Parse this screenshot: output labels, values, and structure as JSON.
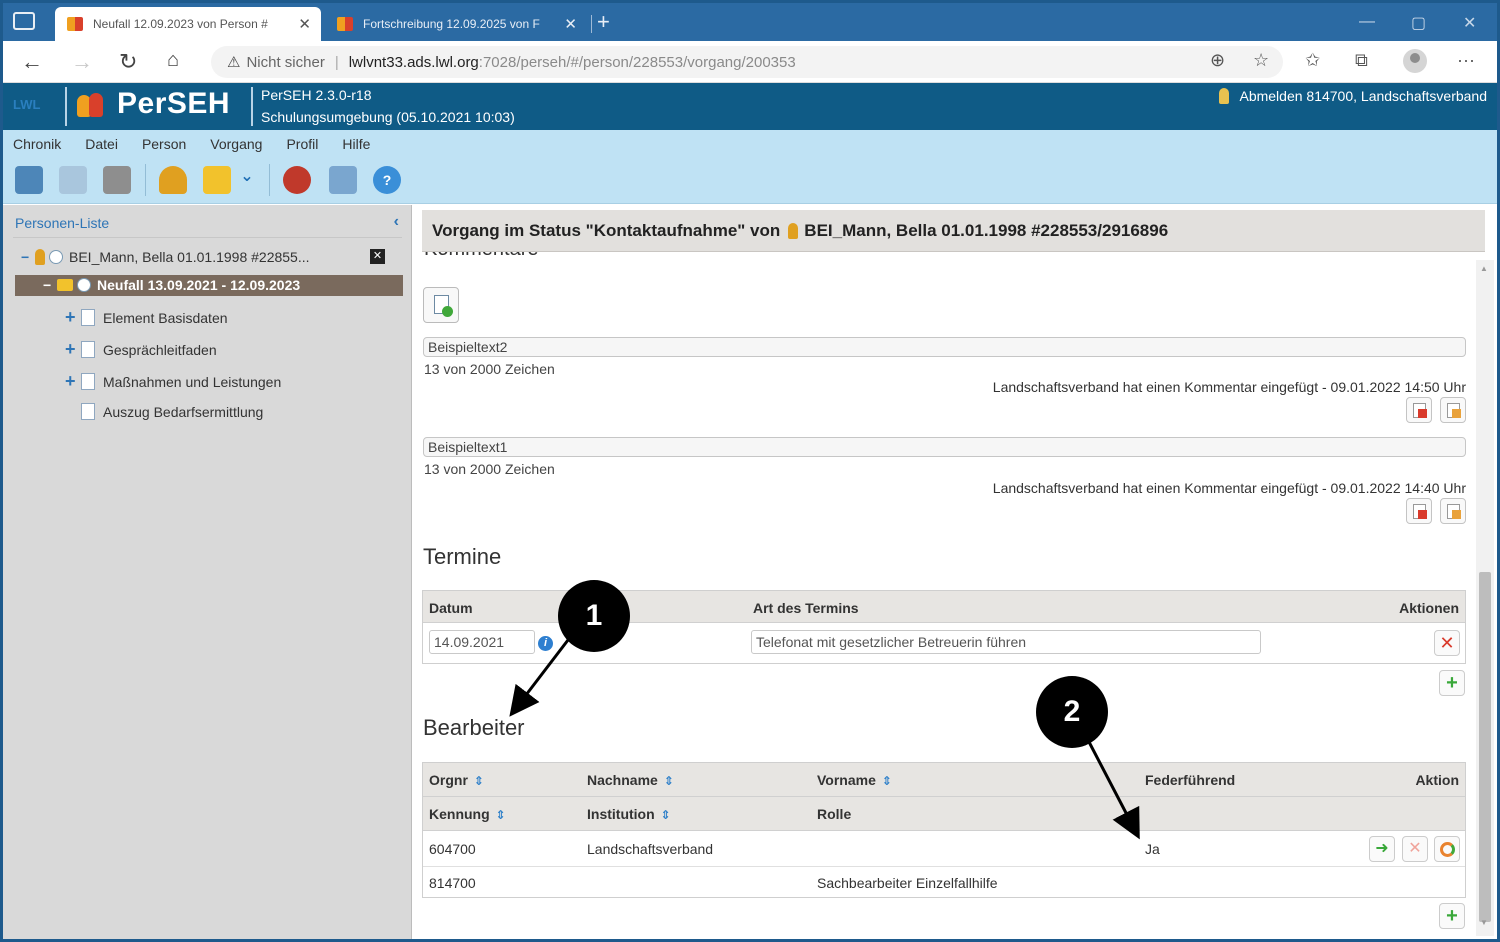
{
  "browser": {
    "tabs": [
      {
        "label": "Neufall 12.09.2023 von Person #",
        "active": true
      },
      {
        "label": "Fortschreibung 12.09.2025 von F",
        "active": false
      }
    ],
    "new_tab_icon": "plus-icon",
    "address": {
      "security_label": "Nicht sicher",
      "url_host": "lwlvnt33.ads.lwl.org",
      "url_path": ":7028/perseh/#/person/228553/vorgang/200353"
    }
  },
  "app": {
    "brand_small": "LWL",
    "title": "PerSEH",
    "version": "PerSEH 2.3.0-r18",
    "environment": "Schulungsumgebung (05.10.2021 10:03)",
    "logout_label": "Abmelden 814700, Landschaftsverband",
    "colors": {
      "header": "#0f5b86",
      "menu": "#bfe2f4"
    }
  },
  "menu": [
    "Chronik",
    "Datei",
    "Person",
    "Vorgang",
    "Profil",
    "Hilfe"
  ],
  "sidebar": {
    "title": "Personen-Liste",
    "person": "BEI_Mann, Bella 01.01.1998 #22855...",
    "case": "Neufall 13.09.2021 - 12.09.2023",
    "items": [
      {
        "label": "Element Basisdaten",
        "expandable": true
      },
      {
        "label": "Gesprächleitfaden",
        "expandable": true
      },
      {
        "label": "Maßnahmen und Leistungen",
        "expandable": true
      },
      {
        "label": "Auszug Bedarfsermittlung",
        "expandable": false
      }
    ]
  },
  "main": {
    "title_prefix": "Vorgang im Status \"Kontaktaufnahme\" von",
    "title_person": "BEI_Mann, Bella 01.01.1998 #228553/2916896",
    "comments": [
      {
        "text": "Beispieltext2",
        "count": "13 von 2000 Zeichen",
        "meta": "Landschaftsverband hat einen Kommentar eingefügt - 09.01.2022 14:50 Uhr"
      },
      {
        "text": "Beispieltext1",
        "count": "13 von 2000 Zeichen",
        "meta": "Landschaftsverband hat einen Kommentar eingefügt - 09.01.2022 14:40 Uhr"
      }
    ],
    "termine": {
      "title": "Termine",
      "headers": {
        "date": "Datum",
        "type": "Art des Termins",
        "actions": "Aktionen"
      },
      "rows": [
        {
          "date": "14.09.2021",
          "type": "Telefonat mit gesetzlicher Betreuerin führen"
        }
      ]
    },
    "bearbeiter": {
      "title": "Bearbeiter",
      "headers": {
        "orgnr": "Orgnr",
        "nachname": "Nachname",
        "vorname": "Vorname",
        "federfuehrend": "Federführend",
        "aktion": "Aktion",
        "kennung": "Kennung",
        "institution": "Institution",
        "rolle": "Rolle"
      },
      "rows": [
        {
          "orgnr": "604700",
          "nachname": "Landschaftsverband",
          "federfuehrend": "Ja"
        },
        {
          "kennung": "814700",
          "rolle": "Sachbearbeiter Einzelfallhilfe"
        }
      ]
    }
  },
  "callouts": [
    "1",
    "2"
  ]
}
